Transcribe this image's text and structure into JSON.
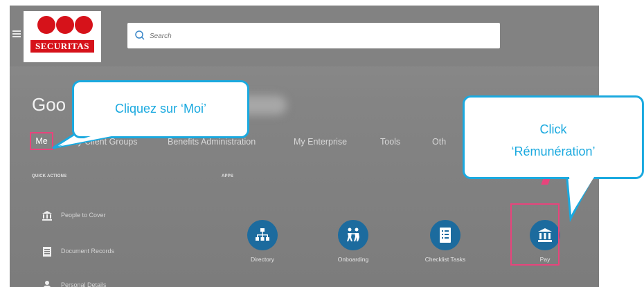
{
  "brand": {
    "logo_text": "SECURITAS",
    "logo_color": "#d6121a"
  },
  "search": {
    "placeholder": "Search"
  },
  "greeting": {
    "text": "Goo"
  },
  "nav": {
    "tabs": [
      "Me",
      "My Client Groups",
      "Benefits Administration",
      "My Enterprise",
      "Tools",
      "Oth"
    ]
  },
  "quick_actions": {
    "heading": "QUICK ACTIONS",
    "items": [
      {
        "label": "People to Cover",
        "icon": "bank-icon"
      },
      {
        "label": "Document Records",
        "icon": "document-icon"
      },
      {
        "label": "Personal Details",
        "icon": "person-icon"
      }
    ]
  },
  "apps": {
    "heading": "APPS",
    "items": [
      {
        "label": "Directory",
        "icon": "hierarchy-icon"
      },
      {
        "label": "Onboarding",
        "icon": "people-walking-icon"
      },
      {
        "label": "Checklist Tasks",
        "icon": "checklist-icon"
      },
      {
        "label": "Pay",
        "icon": "bank-icon"
      }
    ]
  },
  "callouts": {
    "moi": "Cliquez sur ‘Moi’",
    "pay_line1": "Click",
    "pay_line2": "‘Rémunération’"
  },
  "colors": {
    "callout_border": "#1aa9df",
    "highlight": "#e8447c",
    "app_icon": "#1c6b9e"
  }
}
